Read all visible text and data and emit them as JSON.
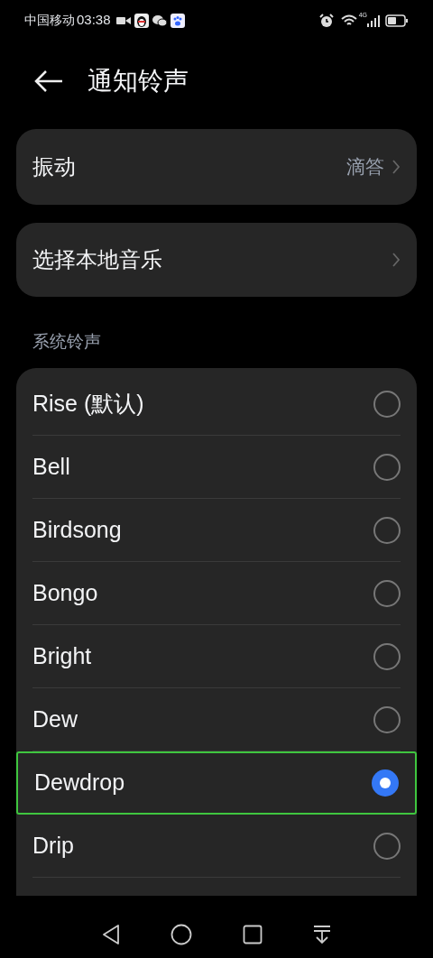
{
  "status_bar": {
    "carrier": "中国移动",
    "time": "03:38",
    "network": "4G"
  },
  "header": {
    "title": "通知铃声"
  },
  "vibration": {
    "label": "振动",
    "value": "滴答"
  },
  "local_music": {
    "label": "选择本地音乐"
  },
  "section": {
    "title": "系统铃声"
  },
  "ringtones": [
    {
      "label": "Rise (默认)",
      "selected": false,
      "focused": false
    },
    {
      "label": "Bell",
      "selected": false,
      "focused": false
    },
    {
      "label": "Birdsong",
      "selected": false,
      "focused": false
    },
    {
      "label": "Bongo",
      "selected": false,
      "focused": false
    },
    {
      "label": "Bright",
      "selected": false,
      "focused": false
    },
    {
      "label": "Dew",
      "selected": false,
      "focused": false
    },
    {
      "label": "Dewdrop",
      "selected": true,
      "focused": true
    },
    {
      "label": "Drip",
      "selected": false,
      "focused": false
    }
  ]
}
